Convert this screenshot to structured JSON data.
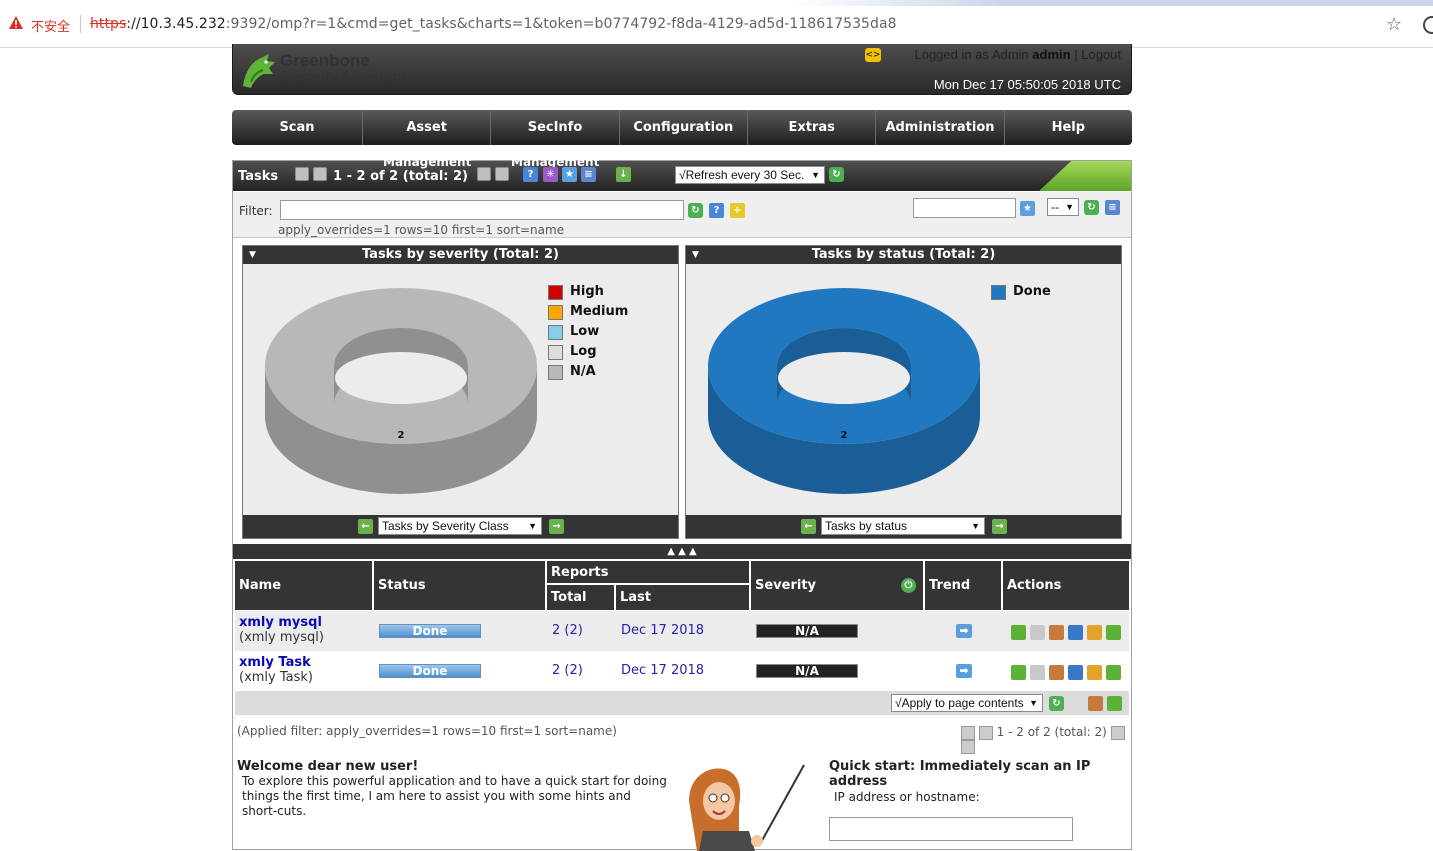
{
  "browser": {
    "insecure_label": "不安全",
    "url_scheme": "https",
    "url_host": "://10.3.45.232",
    "url_rest": ":9392/omp?r=1&cmd=get_tasks&charts=1&token=b0774792-f8da-4129-ad5d-118617535da8"
  },
  "header": {
    "logo_line1": "Greenbone",
    "logo_line2": "Security Assistant",
    "logged_in_prefix": "Logged in as Admin",
    "user": "admin",
    "separator": "|",
    "logout": "Logout",
    "datetime": "Mon Dec 17 05:50:05 2018 UTC",
    "lang_icon": "<>"
  },
  "nav": {
    "items": [
      "Scan Management",
      "Asset",
      "SecInfo",
      "Configuration",
      "Extras",
      "Administration",
      "Help"
    ]
  },
  "tasks": {
    "title": "Tasks",
    "pagination": "1 - 2 of 2 (total: 2)",
    "ghost_labels": [
      "Management",
      "Management"
    ],
    "refresh_select": "√Refresh every 30 Sec.",
    "filter_label": "Filter:",
    "filter_value": "",
    "filter_applied_line": "apply_overrides=1 rows=10 first=1 sort=name",
    "filter_name_value": "",
    "filter_select": "--"
  },
  "charts": {
    "left": {
      "title": "Tasks by severity (Total: 2)",
      "center_label": "2",
      "select": "Tasks by Severity Class",
      "legend": [
        {
          "label": "High",
          "color": "#d00000"
        },
        {
          "label": "Medium",
          "color": "#ffa500"
        },
        {
          "label": "Low",
          "color": "#87ceeb"
        },
        {
          "label": "Log",
          "color": "#dddddd"
        },
        {
          "label": "N/A",
          "color": "#b8b8b8"
        }
      ]
    },
    "right": {
      "title": "Tasks by status (Total: 2)",
      "center_label": "2",
      "select": "Tasks by status",
      "legend": [
        {
          "label": "Done",
          "color": "#2079c0"
        }
      ]
    },
    "collapse_arrows": "▲ ▲ ▲"
  },
  "chart_data": [
    {
      "type": "pie",
      "title": "Tasks by severity (Total: 2)",
      "categories": [
        "High",
        "Medium",
        "Low",
        "Log",
        "N/A"
      ],
      "values": [
        0,
        0,
        0,
        0,
        2
      ],
      "colors": [
        "#d00000",
        "#ffa500",
        "#87ceeb",
        "#dddddd",
        "#b8b8b8"
      ],
      "donut": true,
      "legend": "right"
    },
    {
      "type": "pie",
      "title": "Tasks by status (Total: 2)",
      "categories": [
        "Done"
      ],
      "values": [
        2
      ],
      "colors": [
        "#2079c0"
      ],
      "donut": true,
      "legend": "right"
    }
  ],
  "table": {
    "headers": {
      "name": "Name",
      "status": "Status",
      "reports": "Reports",
      "total": "Total",
      "last": "Last",
      "severity": "Severity",
      "trend": "Trend",
      "actions": "Actions"
    },
    "rows": [
      {
        "name": "xmly mysql",
        "comment": "(xmly mysql)",
        "status": "Done",
        "reports_total": "2",
        "reports_total_paren": "(2)",
        "last": "Dec 17 2018",
        "severity": "N/A"
      },
      {
        "name": "xmly Task",
        "comment": "(xmly Task)",
        "status": "Done",
        "reports_total": "2",
        "reports_total_paren": "(2)",
        "last": "Dec 17 2018",
        "severity": "N/A"
      }
    ],
    "apply_select": "√Apply to page contents",
    "applied_filter": "(Applied filter: apply_overrides=1 rows=10 first=1 sort=name)",
    "bottom_pagination": "1 - 2 of 2 (total: 2)"
  },
  "welcome": {
    "title": "Welcome dear new user!",
    "body": "To explore this powerful application and to have a quick start for doing things the first time, I am here to assist you with some hints and short-cuts."
  },
  "quickstart": {
    "title": "Quick start: Immediately scan an IP address",
    "label": "IP address or hostname:",
    "value": ""
  }
}
